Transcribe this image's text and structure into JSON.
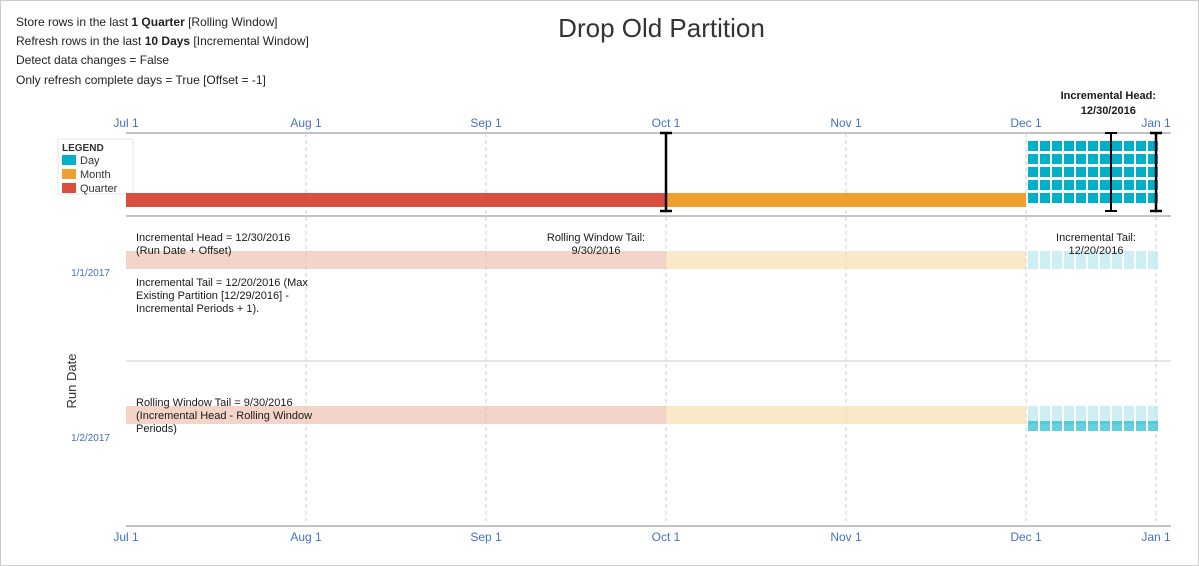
{
  "title": "Drop Old Partition",
  "header": {
    "line1_prefix": "Store rows in the last ",
    "line1_bold": "1 Quarter",
    "line1_suffix": " [Rolling Window]",
    "line2_prefix": "Refresh rows in the last ",
    "line2_bold": "10 Days",
    "line2_suffix": " [Incremental Window]",
    "line3": "Detect data changes = False",
    "line4": "Only refresh complete days = True [Offset = -1]"
  },
  "incremental_head_label": "Incremental Head:\n12/30/2016",
  "axis_labels": [
    "Jul 1",
    "Aug 1",
    "Sep 1",
    "Oct 1",
    "Nov 1",
    "Dec 1",
    "Jan 1"
  ],
  "legend": {
    "title": "LEGEND",
    "items": [
      {
        "label": "Day",
        "color": "#00b0c8"
      },
      {
        "label": "Month",
        "color": "#f0a030"
      },
      {
        "label": "Quarter",
        "color": "#d94f3d"
      }
    ]
  },
  "annotations": {
    "incremental_head": "Incremental Head = 12/30/2016\n(Run Date + Offset)",
    "incremental_tail": "Incremental Tail = 12/20/2016 (Max\nExisting Partition [12/29/2016] -\nIncremental Periods + 1).",
    "rolling_window_tail_top": "Rolling Window Tail:\n9/30/2016",
    "rolling_window_tail_bottom": "Rolling Window Tail = 9/30/2016\n(Incremental Head - Rolling Window\nPeriods)",
    "incremental_tail_right": "Incremental Tail:\n12/20/2016"
  },
  "run_dates": {
    "label": "Run Date",
    "date1": "1/1/2017",
    "date2": "1/2/2017"
  },
  "colors": {
    "day": "#00b0c8",
    "month": "#f0a030",
    "quarter": "#d94f3d",
    "day_light": "#a8dde8",
    "month_light": "#f8d8a0",
    "quarter_light": "#f0b0a0",
    "axis_blue": "#4472c4",
    "black": "#1a1a1a"
  }
}
